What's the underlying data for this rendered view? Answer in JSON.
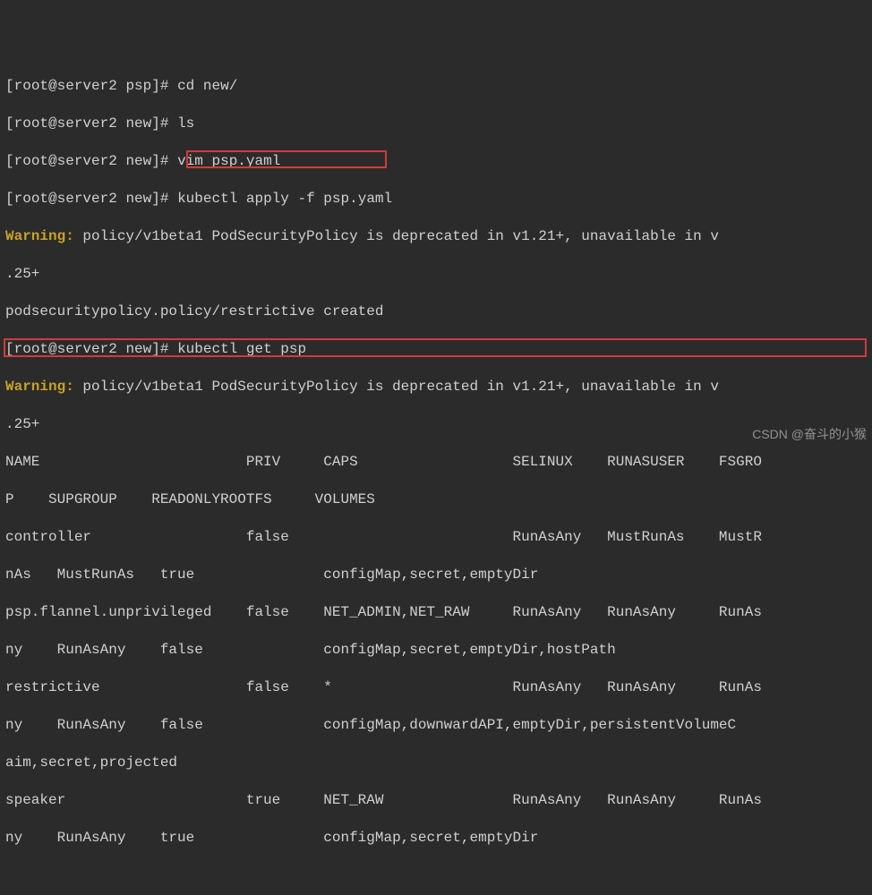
{
  "prompt_user": "root",
  "prompt_host": "server2",
  "prompts": [
    {
      "dir": "psp",
      "cmd": "cd new/"
    },
    {
      "dir": "new",
      "cmd": "ls"
    },
    {
      "dir": "new",
      "cmd": "vim psp.yaml"
    },
    {
      "dir": "new",
      "cmd": "kubectl apply -f psp.yaml"
    }
  ],
  "warning_label": "Warning:",
  "warning_text": " policy/v1beta1 PodSecurityPolicy is deprecated in v1.21+, unavailable in v",
  "warning_cont": ".25+",
  "created_msg": "podsecuritypolicy.policy/restrictive created",
  "prompt5": {
    "dir": "new",
    "cmd": "kubectl get psp"
  },
  "header1": "NAME                        PRIV     CAPS                  SELINUX    RUNASUSER    FSGRO",
  "header2": "P    SUPGROUP    READONLYROOTFS     VOLUMES",
  "row_controller_1": "controller                  false                          RunAsAny   MustRunAs    MustR",
  "row_controller_2": "nAs   MustRunAs   true               configMap,secret,emptyDir",
  "row_flannel_1": "psp.flannel.unprivileged    false    NET_ADMIN,NET_RAW     RunAsAny   RunAsAny     RunAs",
  "row_flannel_2": "ny    RunAsAny    false              configMap,secret,emptyDir,hostPath",
  "row_restrictive_1": "restrictive                 false    *                     RunAsAny   RunAsAny     RunAs",
  "row_restrictive_2": "ny    RunAsAny    false              configMap,downwardAPI,emptyDir,persistentVolumeC",
  "row_restrictive_3": "aim,secret,projected",
  "row_speaker_1": "speaker                     true     NET_RAW               RunAsAny   RunAsAny     RunAs",
  "row_speaker_2": "ny    RunAsAny    true               configMap,secret,emptyDir",
  "watermark": "CSDN @奋斗的小猴"
}
